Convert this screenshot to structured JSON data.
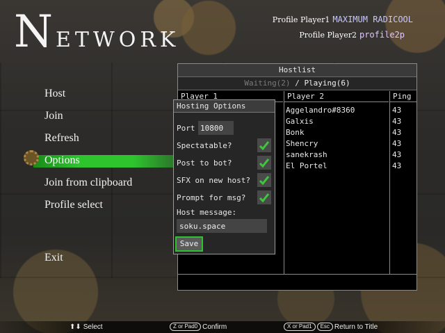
{
  "header": {
    "title_initial": "N",
    "title_rest": "ETWORK",
    "profile1": {
      "label": "Profile Player1",
      "value": "MAXIMUM RADICOOL"
    },
    "profile2": {
      "label": "Profile Player2",
      "value": "profile2p"
    }
  },
  "menu": {
    "items": [
      {
        "label": "Host"
      },
      {
        "label": "Join"
      },
      {
        "label": "Refresh"
      },
      {
        "label": "Options"
      },
      {
        "label": "Join from clipboard"
      },
      {
        "label": "Profile select"
      },
      {
        "label": "Exit"
      }
    ],
    "selected": "Options",
    "selection_color": "#2ec42e"
  },
  "hostlist": {
    "title": "Hostlist",
    "tab_waiting": "Waiting(2)",
    "tab_separator": "/",
    "tab_playing": "Playing(6)",
    "active_tab": "Playing",
    "columns": [
      "Player 1",
      "Player 2",
      "Ping"
    ],
    "rows": [
      {
        "player2": "Aggelandro#8360",
        "ping": "43"
      },
      {
        "player2": "Galxis",
        "ping": "43"
      },
      {
        "player2": "Bonk",
        "ping": "43"
      },
      {
        "player2": "Shencry",
        "ping": "43"
      },
      {
        "player2": "sanekrash",
        "ping": "43"
      },
      {
        "player2": "El Portel",
        "ping": "43"
      }
    ]
  },
  "hosting_options": {
    "title": "Hosting Options",
    "port_label": "Port",
    "port_value": "10800",
    "spectatable_label": "Spectatable?",
    "spectatable": true,
    "post_to_bot_label": "Post to bot?",
    "post_to_bot": true,
    "sfx_label": "SFX on new host?",
    "sfx": true,
    "prompt_label": "Prompt for msg?",
    "prompt": true,
    "host_message_label": "Host message:",
    "host_message_value": "soku.space",
    "save_label": "Save",
    "check_color": "#3cc83c"
  },
  "hints": {
    "select": "Select",
    "confirm_key1": "Z or Pad0",
    "confirm": "Confirm",
    "back_key1": "X or Pad1",
    "back_key2": "Esc",
    "back": "Return to Title"
  }
}
